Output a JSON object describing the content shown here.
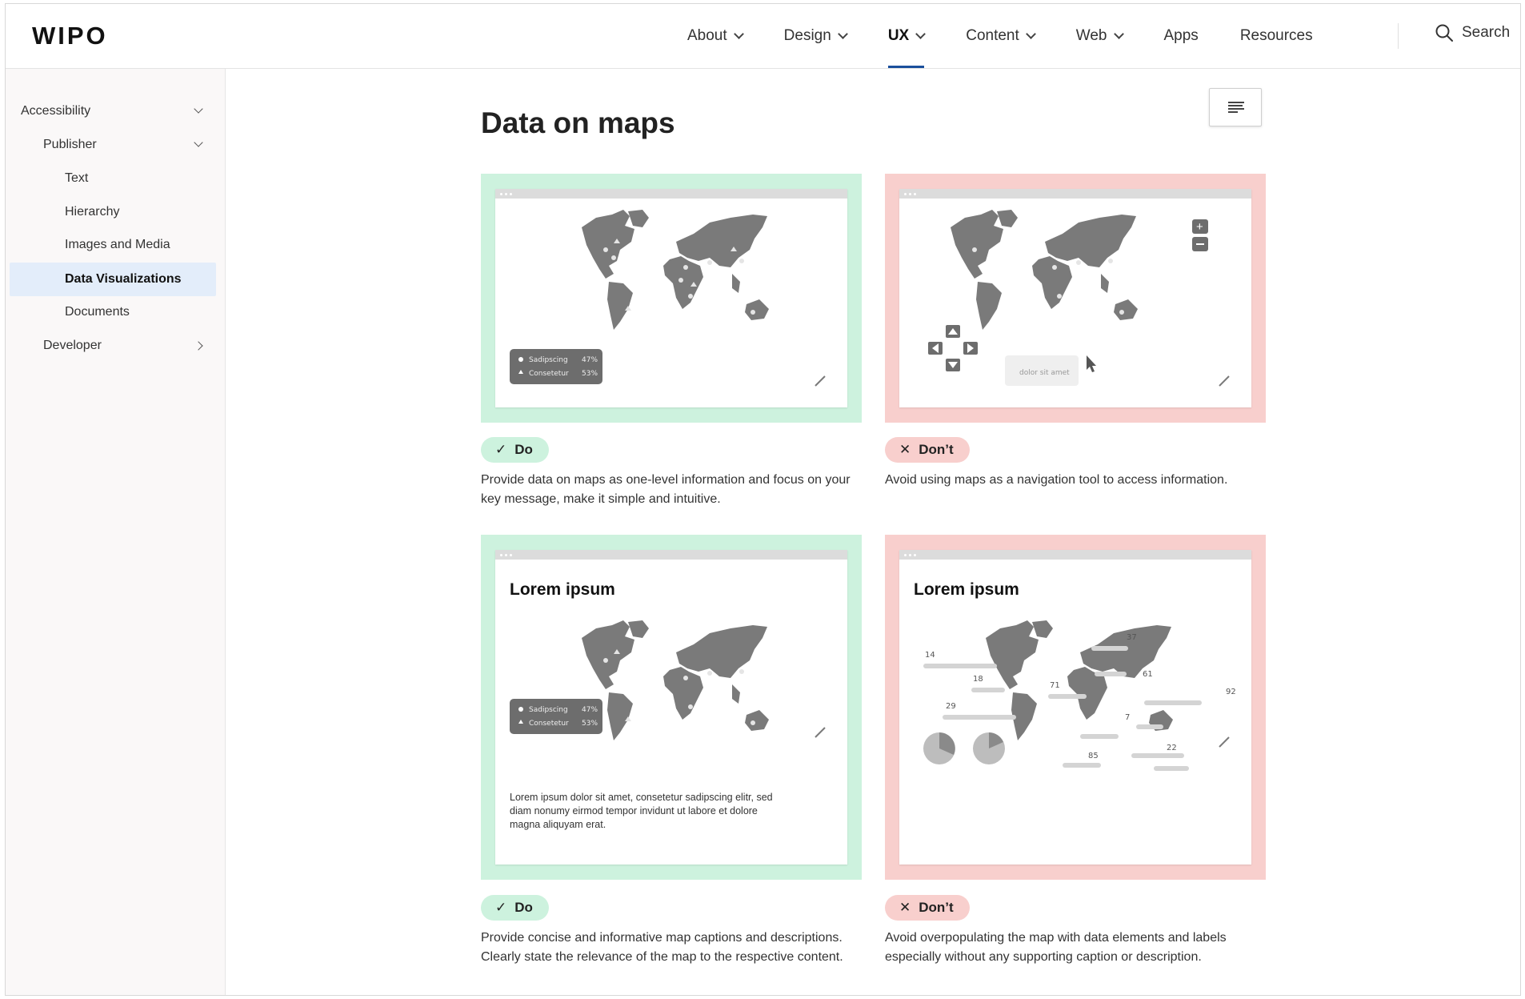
{
  "header": {
    "logo": "WIPO",
    "nav": [
      {
        "label": "About",
        "has_menu": true
      },
      {
        "label": "Design",
        "has_menu": true
      },
      {
        "label": "UX",
        "has_menu": true,
        "active": true
      },
      {
        "label": "Content",
        "has_menu": true
      },
      {
        "label": "Web",
        "has_menu": true
      },
      {
        "label": "Apps",
        "has_menu": false
      },
      {
        "label": "Resources",
        "has_menu": false
      }
    ],
    "search_label": "Search"
  },
  "sidebar": {
    "items": [
      {
        "label": "Accessibility",
        "level": 0,
        "expand": "down"
      },
      {
        "label": "Publisher",
        "level": 1,
        "expand": "down"
      },
      {
        "label": "Text",
        "level": 2
      },
      {
        "label": "Hierarchy",
        "level": 2
      },
      {
        "label": "Images and Media",
        "level": 2
      },
      {
        "label": "Data Visualizations",
        "level": 2,
        "active": true
      },
      {
        "label": "Documents",
        "level": 2
      },
      {
        "label": "Developer",
        "level": 1,
        "expand": "right"
      }
    ]
  },
  "main": {
    "title": "Data on maps",
    "toc_icon": "table-of-contents-icon",
    "examples": [
      {
        "kind": "do",
        "badge": "Do",
        "description": "Provide data on maps as one-level information and focus on your key message, make it simple and intuitive.",
        "legend": [
          {
            "name": "Sadipscing",
            "value": "47%"
          },
          {
            "name": "Consetetur",
            "value": "53%"
          }
        ]
      },
      {
        "kind": "dont",
        "badge": "Don’t",
        "description": "Avoid using maps as a navigation tool to access information.",
        "tooltip": "dolor sit amet"
      },
      {
        "kind": "do",
        "badge": "Do",
        "description": "Provide concise and informative map captions and descriptions. Clearly state the relevance of the map to the respective content.",
        "card_title": "Lorem ipsum",
        "legend": [
          {
            "name": "Sadipscing",
            "value": "47%"
          },
          {
            "name": "Consetetur",
            "value": "53%"
          }
        ],
        "card_text": "Lorem ipsum dolor sit amet, consetetur sadipscing elitr, sed diam nonumy eirmod tempor invidunt ut labore et dolore magna aliquyam erat."
      },
      {
        "kind": "dont",
        "badge": "Don’t",
        "description": "Avoid overpopulating the map with data elements and labels especially without any supporting caption or description.",
        "card_title": "Lorem ipsum",
        "labels": [
          "14",
          "18",
          "29",
          "37",
          "71",
          "61",
          "92",
          "7",
          "22",
          "85"
        ]
      }
    ]
  },
  "colors": {
    "do_bg": "#cdf2de",
    "dont_bg": "#f8cfcd",
    "active_nav": "#1a4f9c",
    "map": "#7a7a7a"
  }
}
